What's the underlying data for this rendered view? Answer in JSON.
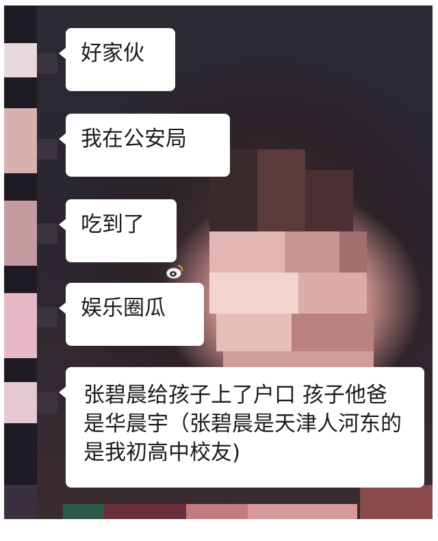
{
  "messages": [
    {
      "text": "好家伙"
    },
    {
      "text": "我在公安局"
    },
    {
      "text": "吃到了"
    },
    {
      "text": "娱乐圈瓜"
    },
    {
      "text": "张碧晨给孩子上了户口 孩子他爸是华晨宇（张碧晨是天津人河东的 是我初高中校友)"
    }
  ],
  "colors": {
    "bubble": "#ffffff",
    "text": "#1b1b1b",
    "background_dark": "#2a2a33",
    "skin": "#d9a6a2"
  },
  "icons": [
    "weibo-logo-icon"
  ]
}
